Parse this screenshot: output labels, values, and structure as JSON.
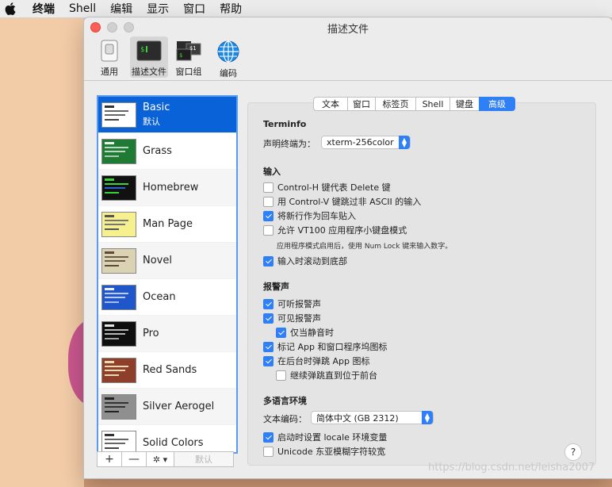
{
  "menubar": {
    "items": [
      "终端",
      "Shell",
      "编辑",
      "显示",
      "窗口",
      "帮助"
    ]
  },
  "window": {
    "title": "描述文件",
    "toolbar": [
      {
        "label": "通用",
        "icon": "switch-icon"
      },
      {
        "label": "描述文件",
        "icon": "terminal-icon"
      },
      {
        "label": "窗口组",
        "icon": "window-group-icon"
      },
      {
        "label": "编码",
        "icon": "globe-icon"
      }
    ]
  },
  "profiles": [
    {
      "name": "Basic",
      "sub": "默认",
      "color": "#ffffff",
      "selected": true
    },
    {
      "name": "Grass",
      "color": "#1f7a34"
    },
    {
      "name": "Homebrew",
      "color": "#111111"
    },
    {
      "name": "Man Page",
      "color": "#f6f08f"
    },
    {
      "name": "Novel",
      "color": "#d9d3b4"
    },
    {
      "name": "Ocean",
      "color": "#1f56c9"
    },
    {
      "name": "Pro",
      "color": "#0f0f0f"
    },
    {
      "name": "Red Sands",
      "color": "#8e3f2b"
    },
    {
      "name": "Silver Aerogel",
      "color": "#8f8f8f"
    },
    {
      "name": "Solid Colors",
      "color": "#ffffff"
    }
  ],
  "list_buttons": {
    "add": "+",
    "remove": "—",
    "gear": "✲ ▾",
    "default": "默认"
  },
  "tabs": [
    "文本",
    "窗口",
    "标签页",
    "Shell",
    "键盘",
    "高级"
  ],
  "active_tab": "高级",
  "panel": {
    "terminfo": {
      "heading": "Terminfo",
      "label": "声明终端为：",
      "value": "xterm-256color"
    },
    "input": {
      "heading": "输入",
      "options": [
        {
          "label": "Control-H 键代表 Delete 键",
          "checked": false
        },
        {
          "label": "用 Control-V 键跳过非 ASCII 的输入",
          "checked": false
        },
        {
          "label": "将新行作为回车贴入",
          "checked": true
        },
        {
          "label": "允许 VT100 应用程序小键盘模式",
          "checked": false
        },
        {
          "label": "输入时滚动到底部",
          "checked": true
        }
      ],
      "note": "应用程序模式启用后，使用 Num Lock 键来输入数字。"
    },
    "bell": {
      "heading": "报警声",
      "options": [
        {
          "label": "可听报警声",
          "checked": true
        },
        {
          "label": "可见报警声",
          "checked": true
        },
        {
          "label": "仅当静音时",
          "checked": true
        },
        {
          "label": "标记 App 和窗口程序坞图标",
          "checked": true
        },
        {
          "label": "在后台时弹跳 App 图标",
          "checked": true
        },
        {
          "label": "继续弹跳直到位于前台",
          "checked": false
        }
      ]
    },
    "locale": {
      "heading": "多语言环境",
      "encoding_label": "文本编码：",
      "encoding_value": "简体中文 (GB 2312)",
      "options": [
        {
          "label": "启动时设置 locale 环境变量",
          "checked": true
        },
        {
          "label": "Unicode 东亚模糊字符较宽",
          "checked": false
        }
      ]
    },
    "help": "?"
  },
  "watermark": "https://blog.csdn.net/leisha2007"
}
